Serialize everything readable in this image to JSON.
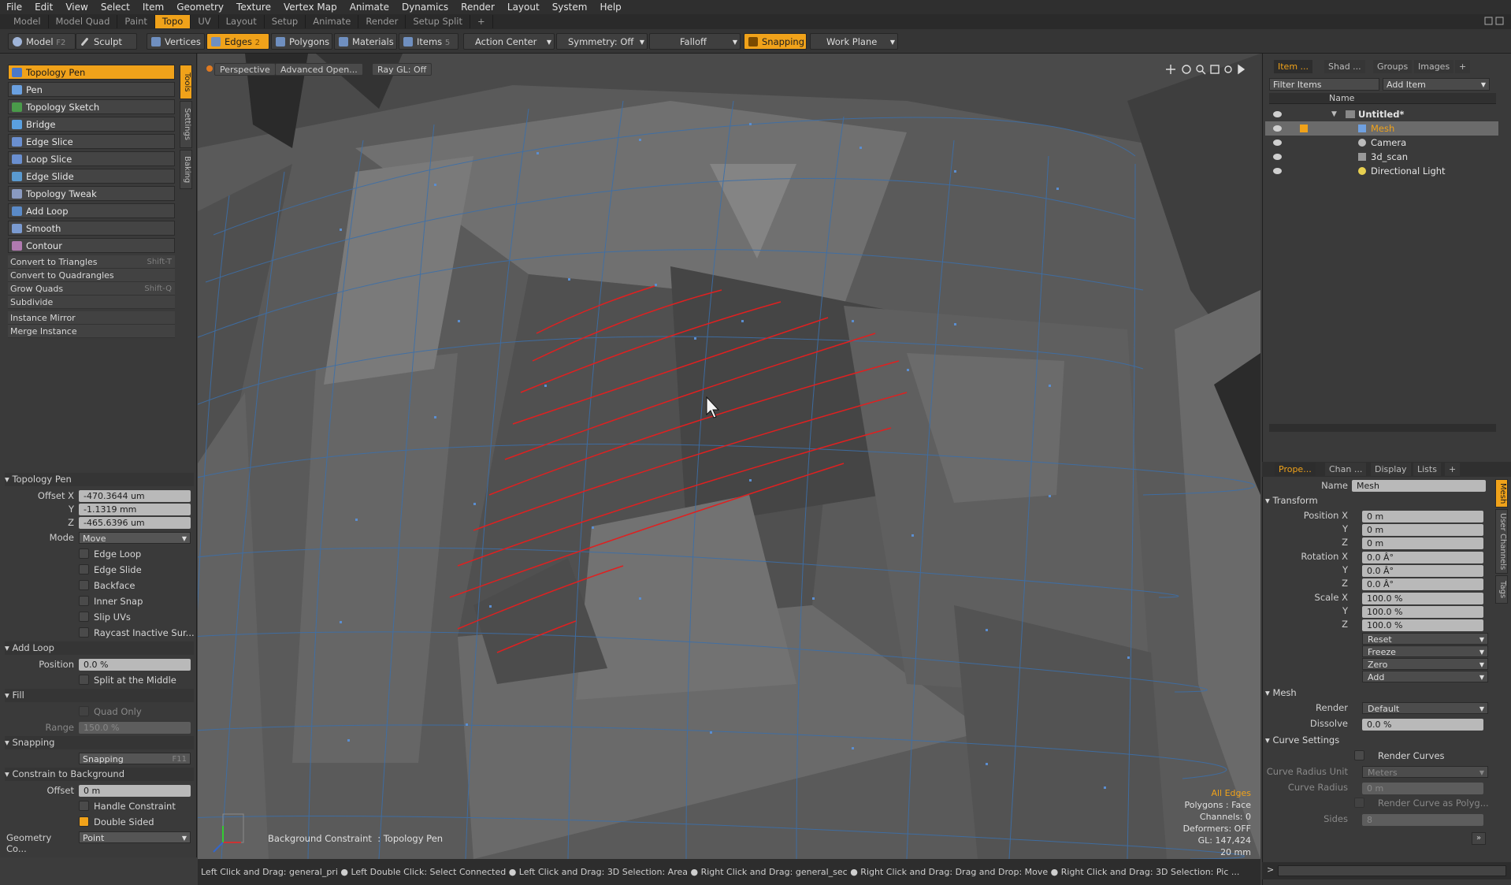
{
  "menu": [
    "File",
    "Edit",
    "View",
    "Select",
    "Item",
    "Geometry",
    "Texture",
    "Vertex Map",
    "Animate",
    "Dynamics",
    "Render",
    "Layout",
    "System",
    "Help"
  ],
  "layout_tabs": [
    "Model",
    "Model Quad",
    "Paint",
    "Topo",
    "UV",
    "Layout",
    "Setup",
    "Animate",
    "Render",
    "Setup Split",
    "+"
  ],
  "toolbar": {
    "model": "Model",
    "model_key": "F2",
    "sculpt": "Sculpt",
    "vertices": "Vertices",
    "edges": "Edges",
    "edges_key": "2",
    "polygons": "Polygons",
    "materials": "Materials",
    "items": "Items",
    "items_key": "5",
    "action_center": "Action Center",
    "symmetry": "Symmetry: Off",
    "falloff": "Falloff",
    "snapping": "Snapping",
    "work_plane": "Work Plane"
  },
  "tools": [
    "Topology Pen",
    "Pen",
    "Topology Sketch",
    "Bridge",
    "Edge Slice",
    "Loop Slice",
    "Edge Slide",
    "Topology Tweak",
    "Add Loop",
    "Smooth",
    "Contour"
  ],
  "commands": [
    {
      "label": "Convert to Triangles",
      "key": "Shift-T"
    },
    {
      "label": "Convert to Quadrangles",
      "key": ""
    },
    {
      "label": "Grow Quads",
      "key": "Shift-Q"
    },
    {
      "label": "Subdivide",
      "key": ""
    },
    {
      "label": "Instance Mirror",
      "key": ""
    },
    {
      "label": "Merge Instance",
      "key": ""
    }
  ],
  "side_tabs": [
    "Tools",
    "Settings",
    "Baking"
  ],
  "props_left": {
    "section": "Topology Pen",
    "offset_x_label": "Offset X",
    "offset_x": "-470.3644 um",
    "y_label": "Y",
    "offset_y": "-1.1319 mm",
    "z_label": "Z",
    "offset_z": "-465.6396 um",
    "mode_label": "Mode",
    "mode": "Move",
    "checks": [
      "Edge Loop",
      "Edge Slide",
      "Backface",
      "Inner Snap",
      "Slip UVs",
      "Raycast Inactive Sur..."
    ],
    "add_loop": "Add Loop",
    "position_label": "Position",
    "position": "0.0 %",
    "split_middle": "Split at the Middle",
    "fill": "Fill",
    "quad_only": "Quad Only",
    "range_label": "Range",
    "range": "150.0 %",
    "snapping": "Snapping",
    "snapping_btn": "Snapping",
    "snapping_key": "F11",
    "constrain": "Constrain to Background",
    "offset_label": "Offset",
    "offset": "0 m",
    "handle_constraint": "Handle Constraint",
    "double_sided": "Double Sided",
    "geo_label": "Geometry Co...",
    "geo": "Point"
  },
  "viewport": {
    "perspective": "Perspective",
    "shading": "Advanced Open...",
    "raygl": "Ray GL: Off",
    "info": [
      "All Edges",
      "Polygons : Face",
      "Channels: 0",
      "Deformers: OFF",
      "GL: 147,424",
      "20 mm"
    ],
    "bg_constraint": "Background Constraint",
    "topo_pen": ": Topology Pen"
  },
  "status_text": "Left Click and Drag: general_pri ●  Left Double Click: Select Connected ●  Left Click and Drag: 3D Selection: Area ●  Right Click and Drag: general_sec ●  Right Click and Drag: Drag and Drop: Move ●  Right Click and Drag: 3D Selection: Pic ...",
  "right_tabs": [
    "Item ...",
    "Shad ...",
    "Groups",
    "Images",
    "+"
  ],
  "filter_items": "Filter Items",
  "add_item": "Add Item",
  "tree_header": "Name",
  "tree": [
    "Untitled*",
    "Mesh",
    "Camera",
    "3d_scan",
    "Directional Light"
  ],
  "prop_tabs": [
    "Prope...",
    "Chan ...",
    "Display",
    "Lists",
    "+"
  ],
  "props": {
    "name_label": "Name",
    "name": "Mesh",
    "transform": "Transform",
    "pos_label": "Position X",
    "pos_x": "0 m",
    "pos_y": "0 m",
    "pos_z": "0 m",
    "rot_label": "Rotation X",
    "rot_x": "0.0 Â°",
    "rot_y": "0.0 Â°",
    "rot_z": "0.0 Â°",
    "scale_label": "Scale X",
    "scale_x": "100.0 %",
    "scale_y": "100.0 %",
    "scale_z": "100.0 %",
    "y": "Y",
    "z": "Z",
    "reset": "Reset",
    "freeze": "Freeze",
    "zero": "Zero",
    "add": "Add",
    "mesh": "Mesh",
    "render_label": "Render",
    "render": "Default",
    "dissolve_label": "Dissolve",
    "dissolve": "0.0 %",
    "curve_settings": "Curve Settings",
    "render_curves": "Render Curves",
    "curve_radius_unit_label": "Curve Radius Unit",
    "curve_radius_unit": "Meters",
    "curve_radius_label": "Curve Radius",
    "curve_radius": "0 m",
    "render_curve_poly": "Render Curve as Polyg...",
    "sides_label": "Sides",
    "sides": "8"
  },
  "right_vtabs": [
    "Mesh",
    "User Channels",
    "Tags"
  ],
  "colors": {
    "accent": "#f0a21a",
    "selection": "#e02020",
    "edges": "#3d6fa8"
  }
}
